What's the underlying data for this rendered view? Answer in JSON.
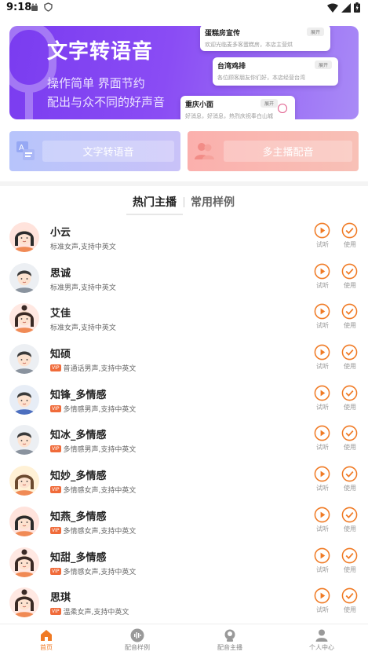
{
  "status_bar": {
    "time": "9:18"
  },
  "banner": {
    "title": "文字转语音",
    "subtitle_1": "操作简单 界面节约",
    "subtitle_2": "配出与众不同的好声音",
    "cards": [
      {
        "title": "蛋糕房宣传",
        "text": "欢迎光临麦多客蛋糕房，本店主营烘",
        "badge": "展开"
      },
      {
        "title": "台湾鸡排",
        "text": "各位顾客朋友你们好，本店经营台湾",
        "badge": "展开"
      },
      {
        "title": "重庆小面",
        "text": "好消息，好消息，热烈庆祝奉白山城",
        "badge": "展开"
      }
    ]
  },
  "functions": {
    "tts_label": "文字转语音",
    "multi_label": "多主播配音"
  },
  "tabs": {
    "active": "热门主播",
    "inactive": "常用样例"
  },
  "actions": {
    "play_label": "试听",
    "use_label": "使用"
  },
  "voices": [
    {
      "name": "小云",
      "desc": "标准女声,支持中英文",
      "vip": false,
      "avatar": "female"
    },
    {
      "name": "思诚",
      "desc": "标准男声,支持中英文",
      "vip": false,
      "avatar": "male"
    },
    {
      "name": "艾佳",
      "desc": "标准女声,支持中英文",
      "vip": false,
      "avatar": "female-bun"
    },
    {
      "name": "知硕",
      "desc": "普通话男声,支持中英文",
      "vip": true,
      "avatar": "male"
    },
    {
      "name": "知锋_多情感",
      "desc": "多情感男声,支持中英文",
      "vip": true,
      "avatar": "male-suit"
    },
    {
      "name": "知冰_多情感",
      "desc": "多情感男声,支持中英文",
      "vip": true,
      "avatar": "male"
    },
    {
      "name": "知妙_多情感",
      "desc": "多情感女声,支持中英文",
      "vip": true,
      "avatar": "female-long"
    },
    {
      "name": "知燕_多情感",
      "desc": "多情感女声,支持中英文",
      "vip": true,
      "avatar": "female"
    },
    {
      "name": "知甜_多情感",
      "desc": "多情感女声,支持中英文",
      "vip": true,
      "avatar": "female-bun"
    },
    {
      "name": "思琪",
      "desc": "温柔女声,支持中英文",
      "vip": true,
      "avatar": "female-bun"
    }
  ],
  "vip_label": "VIP",
  "bottom_nav": [
    {
      "label": "首页",
      "icon": "home-icon",
      "active": true
    },
    {
      "label": "配音样例",
      "icon": "sound-wave-icon",
      "active": false
    },
    {
      "label": "配音主播",
      "icon": "anchor-icon",
      "active": false
    },
    {
      "label": "个人中心",
      "icon": "person-icon",
      "active": false
    }
  ],
  "colors": {
    "accent": "#f07a24",
    "banner": "#7a3cf0",
    "vip": "#f06b3a"
  }
}
